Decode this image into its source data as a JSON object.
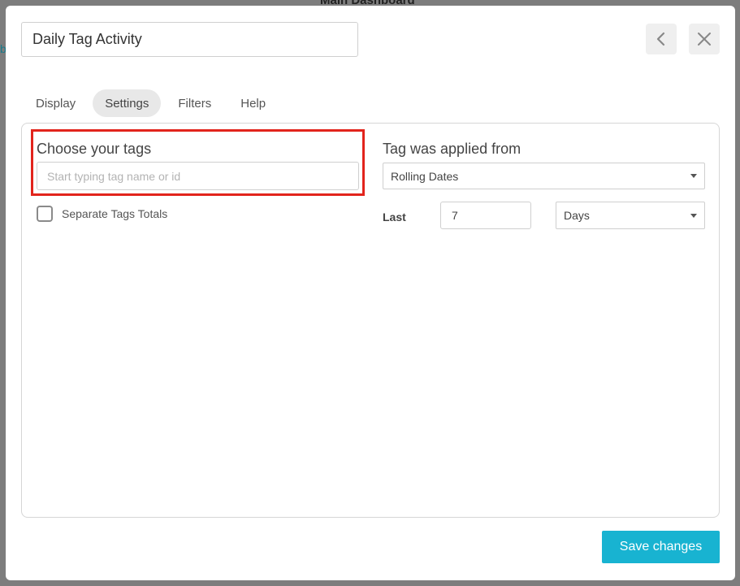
{
  "backdrop": {
    "title": "Main Dashboard",
    "link_fragment": "b"
  },
  "modal": {
    "title_value": "Daily Tag Activity",
    "back_icon": "chevron-left-icon",
    "close_icon": "close-icon"
  },
  "tabs": [
    {
      "label": "Display"
    },
    {
      "label": "Settings",
      "active": true
    },
    {
      "label": "Filters"
    },
    {
      "label": "Help"
    }
  ],
  "tags_section": {
    "title": "Choose your tags",
    "input_placeholder": "Start typing tag name or id",
    "input_value": "",
    "checkbox_label": "Separate Tags Totals",
    "checkbox_checked": false,
    "highlight_color": "#e2241c"
  },
  "applied_section": {
    "title": "Tag was applied from",
    "date_range_value": "Rolling Dates",
    "last_label": "Last",
    "last_value": "7",
    "unit_value": "Days"
  },
  "footer": {
    "save_label": "Save changes",
    "save_color": "#18b3d1"
  }
}
